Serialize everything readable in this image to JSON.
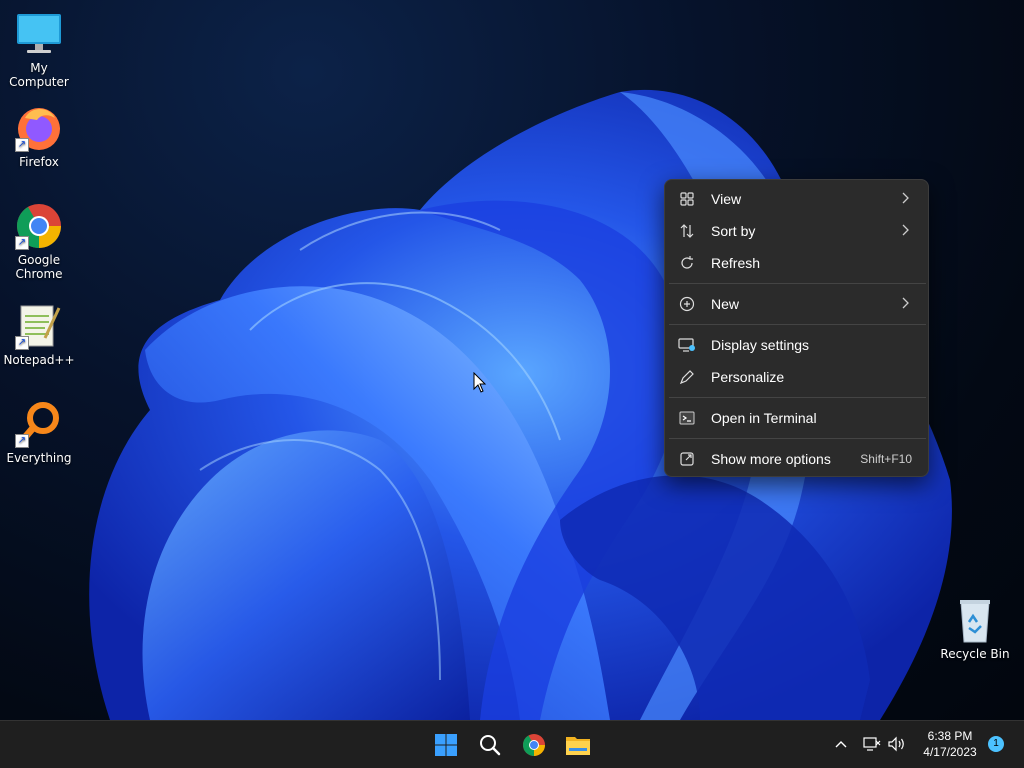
{
  "desktop": {
    "icons": [
      {
        "label": "My Computer",
        "icon": "monitor-icon"
      },
      {
        "label": "Firefox",
        "icon": "firefox-icon"
      },
      {
        "label": "Google Chrome",
        "icon": "chrome-icon"
      },
      {
        "label": "Notepad++",
        "icon": "notepadpp-icon"
      },
      {
        "label": "Everything",
        "icon": "everything-search-icon"
      },
      {
        "label": "Recycle Bin",
        "icon": "recycle-bin-icon"
      }
    ]
  },
  "context_menu": {
    "items": [
      {
        "label": "View",
        "icon": "grid-icon",
        "submenu": true
      },
      {
        "label": "Sort by",
        "icon": "sort-icon",
        "submenu": true
      },
      {
        "label": "Refresh",
        "icon": "refresh-icon"
      },
      {
        "label": "New",
        "icon": "plus-circle-icon",
        "submenu": true
      },
      {
        "label": "Display settings",
        "icon": "display-settings-icon"
      },
      {
        "label": "Personalize",
        "icon": "pen-icon"
      },
      {
        "label": "Open in Terminal",
        "icon": "terminal-icon"
      },
      {
        "label": "Show more options",
        "icon": "more-options-icon",
        "shortcut": "Shift+F10"
      }
    ]
  },
  "taskbar": {
    "apps": [
      "start-icon",
      "search-icon",
      "chrome-icon",
      "file-explorer-icon"
    ],
    "clock": {
      "time": "6:38 PM",
      "date": "4/17/2023"
    },
    "notification_count": "1"
  },
  "colors": {
    "accent": "#4cc2ff",
    "menu_bg": "#2b2b2b",
    "taskbar_bg": "#1f1f1f"
  }
}
